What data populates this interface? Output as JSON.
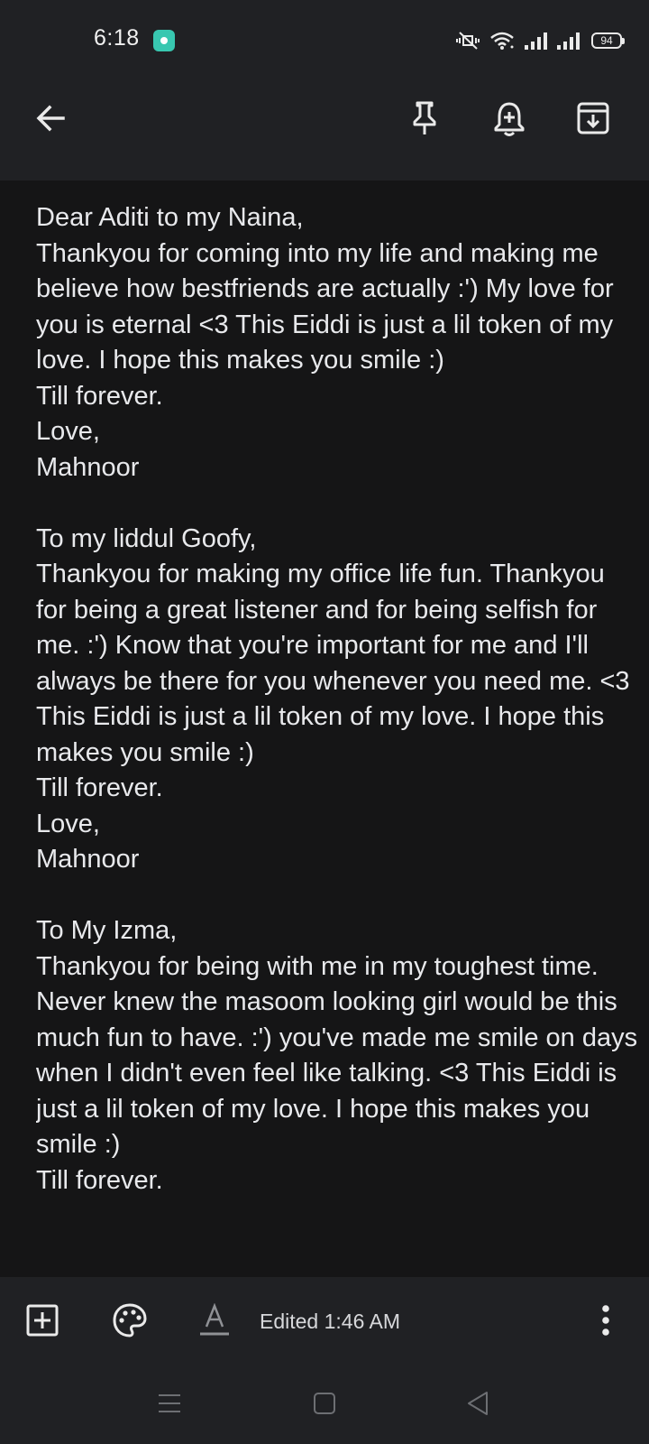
{
  "status_bar": {
    "time": "6:18",
    "battery": "94",
    "icons": [
      "app-notification-icon",
      "vibrate-mute-icon",
      "wifi-icon",
      "signal-icon",
      "signal-icon",
      "battery-icon"
    ]
  },
  "app_bar": {
    "icons": [
      "back-arrow-icon",
      "pin-icon",
      "reminder-bell-icon",
      "archive-icon"
    ]
  },
  "note": {
    "text": "Dear Aditi to my Naina,\nThankyou for coming into my life and making me believe how bestfriends are actually :') My love for you is eternal <3 This Eiddi is just a lil token of my love. I hope this makes you smile :)\nTill forever.\nLove,\nMahnoor\n\nTo my liddul Goofy,\nThankyou for making my office life fun. Thankyou for being a great listener and for being selfish for me. :') Know that you're important for me and I'll always be there for you whenever you need me. <3 This Eiddi is just a lil token of my love. I hope this makes you smile :)\nTill forever.\nLove,\nMahnoor\n\nTo My Izma,\nThankyou for being with me in my toughest time. Never knew the masoom looking girl would be this much fun to have. :') you've made me smile on days when I didn't even feel like talking. <3 This Eiddi is just a lil token of my love. I hope this makes you smile :)\nTill forever."
  },
  "bottom_toolbar": {
    "edited_label": "Edited 1:46 AM",
    "icons": [
      "add-box-icon",
      "palette-icon",
      "text-format-icon",
      "more-vert-icon"
    ]
  },
  "nav_bar": {
    "icons": [
      "recents-menu-icon",
      "home-square-icon",
      "back-triangle-icon"
    ]
  },
  "colors": {
    "background": "#151516",
    "chrome": "#202124",
    "text": "#e8e9ec",
    "notification_accent": "#38c7b0"
  }
}
